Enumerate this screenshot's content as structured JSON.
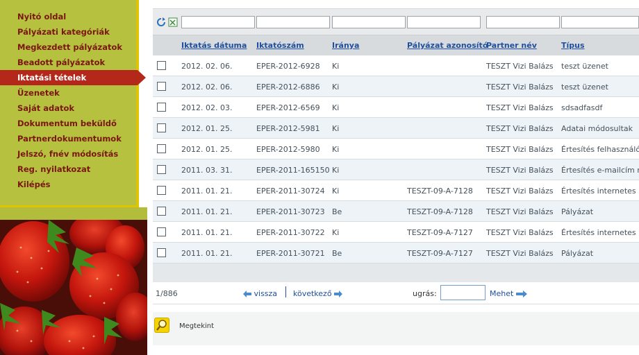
{
  "sidebar": {
    "items": [
      {
        "label": "Nyitó oldal",
        "active": false
      },
      {
        "label": "Pályázati kategóriák",
        "active": false
      },
      {
        "label": "Megkezdett pályázatok",
        "active": false
      },
      {
        "label": "Beadott pályázatok",
        "active": false
      },
      {
        "label": "Iktatási tételek",
        "active": true
      },
      {
        "label": "Üzenetek",
        "active": false
      },
      {
        "label": "Saját adatok",
        "active": false
      },
      {
        "label": "Dokumentum beküldő",
        "active": false
      },
      {
        "label": "Partnerdokumentumok",
        "active": false
      },
      {
        "label": "Jelszó, fnév módosítás",
        "active": false
      },
      {
        "label": "Reg. nyilatkozat",
        "active": false
      },
      {
        "label": "Kilépés",
        "active": false
      }
    ]
  },
  "filters": {
    "values": [
      "",
      "",
      "",
      "",
      "",
      ""
    ]
  },
  "table": {
    "columns": [
      "Iktatás dátuma",
      "Iktatószám",
      "Iránya",
      "Pályázat azonosító",
      "Partner név",
      "Típus"
    ],
    "rows": [
      [
        "2012. 02. 06.",
        "EPER-2012-6928",
        "Ki",
        "",
        "TESZT Vizi Balázs",
        "teszt üzenet"
      ],
      [
        "2012. 02. 06.",
        "EPER-2012-6886",
        "Ki",
        "",
        "TESZT Vizi Balázs",
        "teszt üzenet"
      ],
      [
        "2012. 02. 03.",
        "EPER-2012-6569",
        "Ki",
        "",
        "TESZT Vizi Balázs",
        "sdsadfasdf"
      ],
      [
        "2012. 01. 25.",
        "EPER-2012-5981",
        "Ki",
        "",
        "TESZT Vizi Balázs",
        "Adatai módosultak"
      ],
      [
        "2012. 01. 25.",
        "EPER-2012-5980",
        "Ki",
        "",
        "TESZT Vizi Balázs",
        "Értesítés felhasználó"
      ],
      [
        "2011. 03. 31.",
        "EPER-2011-165150",
        "Ki",
        "",
        "TESZT Vizi Balázs",
        "Értesítés e-mailcím m"
      ],
      [
        "2011. 01. 21.",
        "EPER-2011-30724",
        "Ki",
        "TESZT-09-A-7128",
        "TESZT Vizi Balázs",
        "Értesítés internetes p"
      ],
      [
        "2011. 01. 21.",
        "EPER-2011-30723",
        "Be",
        "TESZT-09-A-7128",
        "TESZT Vizi Balázs",
        "Pályázat"
      ],
      [
        "2011. 01. 21.",
        "EPER-2011-30722",
        "Ki",
        "TESZT-09-A-7127",
        "TESZT Vizi Balázs",
        "Értesítés internetes p"
      ],
      [
        "2011. 01. 21.",
        "EPER-2011-30721",
        "Be",
        "TESZT-09-A-7127",
        "TESZT Vizi Balázs",
        "Pályázat"
      ]
    ]
  },
  "pager": {
    "count": "1/886",
    "back_label": "vissza",
    "next_label": "következő",
    "jump_label": "ugrás:",
    "jump_value": "",
    "go_label": "Mehet"
  },
  "bottom": {
    "view_label": "Megtekint"
  },
  "colors": {
    "sidebar_bg": "#b6c23f",
    "active_item": "#b4271b",
    "menu_text": "#7a1712",
    "link_blue": "#1f4fa0"
  }
}
